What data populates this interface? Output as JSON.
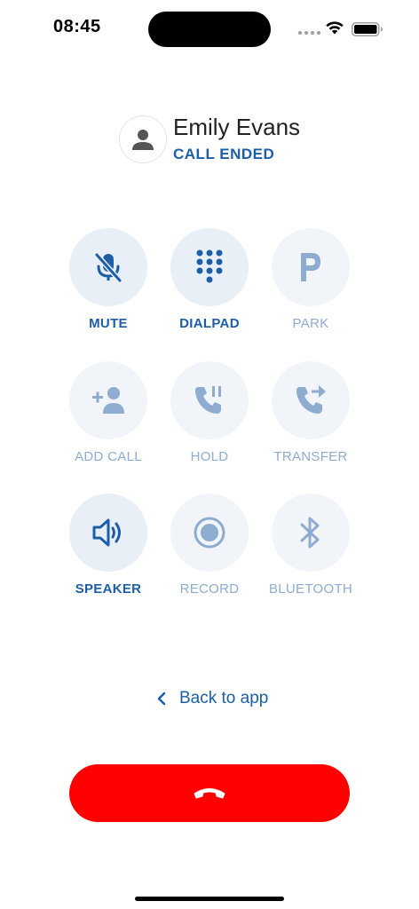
{
  "status_bar": {
    "time": "08:45"
  },
  "contact": {
    "name": "Emily Evans",
    "status": "CALL ENDED"
  },
  "controls": [
    {
      "label": "MUTE",
      "icon": "mic-off-icon",
      "active": true
    },
    {
      "label": "DIALPAD",
      "icon": "dialpad-icon",
      "active": true
    },
    {
      "label": "PARK",
      "icon": "park-icon",
      "active": false
    },
    {
      "label": "ADD CALL",
      "icon": "add-person-icon",
      "active": false
    },
    {
      "label": "HOLD",
      "icon": "phone-pause-icon",
      "active": false
    },
    {
      "label": "TRANSFER",
      "icon": "phone-forward-icon",
      "active": false
    },
    {
      "label": "SPEAKER",
      "icon": "speaker-icon",
      "active": true
    },
    {
      "label": "RECORD",
      "icon": "record-icon",
      "active": false
    },
    {
      "label": "BLUETOOTH",
      "icon": "bluetooth-icon",
      "active": false
    }
  ],
  "navigation": {
    "back_label": "Back to app"
  },
  "colors": {
    "accent": "#1c5fa8",
    "inactive": "#8eacd0",
    "end_call": "#ff0000"
  }
}
